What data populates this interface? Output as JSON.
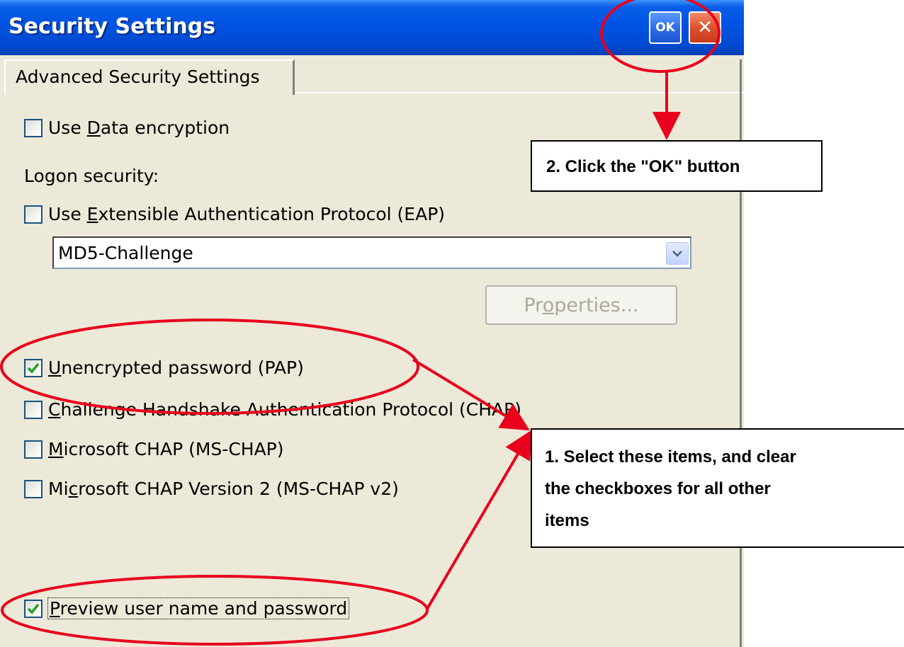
{
  "window": {
    "title": "Security Settings",
    "ok_label": "OK",
    "close_label": "✕"
  },
  "tabs": [
    {
      "label": "Advanced Security Settings",
      "selected": true
    }
  ],
  "options": {
    "data_encryption": {
      "label_pre": "Use ",
      "accel": "D",
      "label_post": "ata encryption",
      "checked": false
    },
    "logon_security_label": "Logon security:",
    "eap": {
      "label_pre": "Use ",
      "accel": "E",
      "label_post": "xtensible Authentication Protocol (EAP)",
      "checked": false
    },
    "eap_method": "MD5-Challenge",
    "properties_button": {
      "label_pre": "Pr",
      "accel": "o",
      "label_post": "perties...",
      "enabled": false
    },
    "pap": {
      "label_pre": "",
      "accel": "U",
      "label_post": "nencrypted password (PAP)",
      "checked": true
    },
    "chap": {
      "label_pre": "",
      "accel": "C",
      "label_post": "hallenge Handshake Authentication Protocol (CHAP)",
      "checked": false
    },
    "ms_chap": {
      "label_pre": "",
      "accel": "M",
      "label_post": "icrosoft CHAP (MS-CHAP)",
      "checked": false
    },
    "ms_chap_v2": {
      "label_pre": "Mi",
      "accel": "c",
      "label_post": "rosoft CHAP Version 2 (MS-CHAP v2)",
      "checked": false
    },
    "preview": {
      "label_pre": "",
      "accel": "P",
      "label_post": "review user name and password",
      "checked": true
    }
  },
  "annotations": {
    "step2": "2. Click the \"OK\" button",
    "step1_line1": "1. Select these items, and clear",
    "step1_line2": "the checkboxes for all other",
    "step1_line3": "items",
    "color": "#e8001c"
  },
  "colors": {
    "titlebar": "#0054e3",
    "window_bg": "#ece9d8",
    "checkbox_border": "#1c5180",
    "checkmark": "#21a121"
  }
}
